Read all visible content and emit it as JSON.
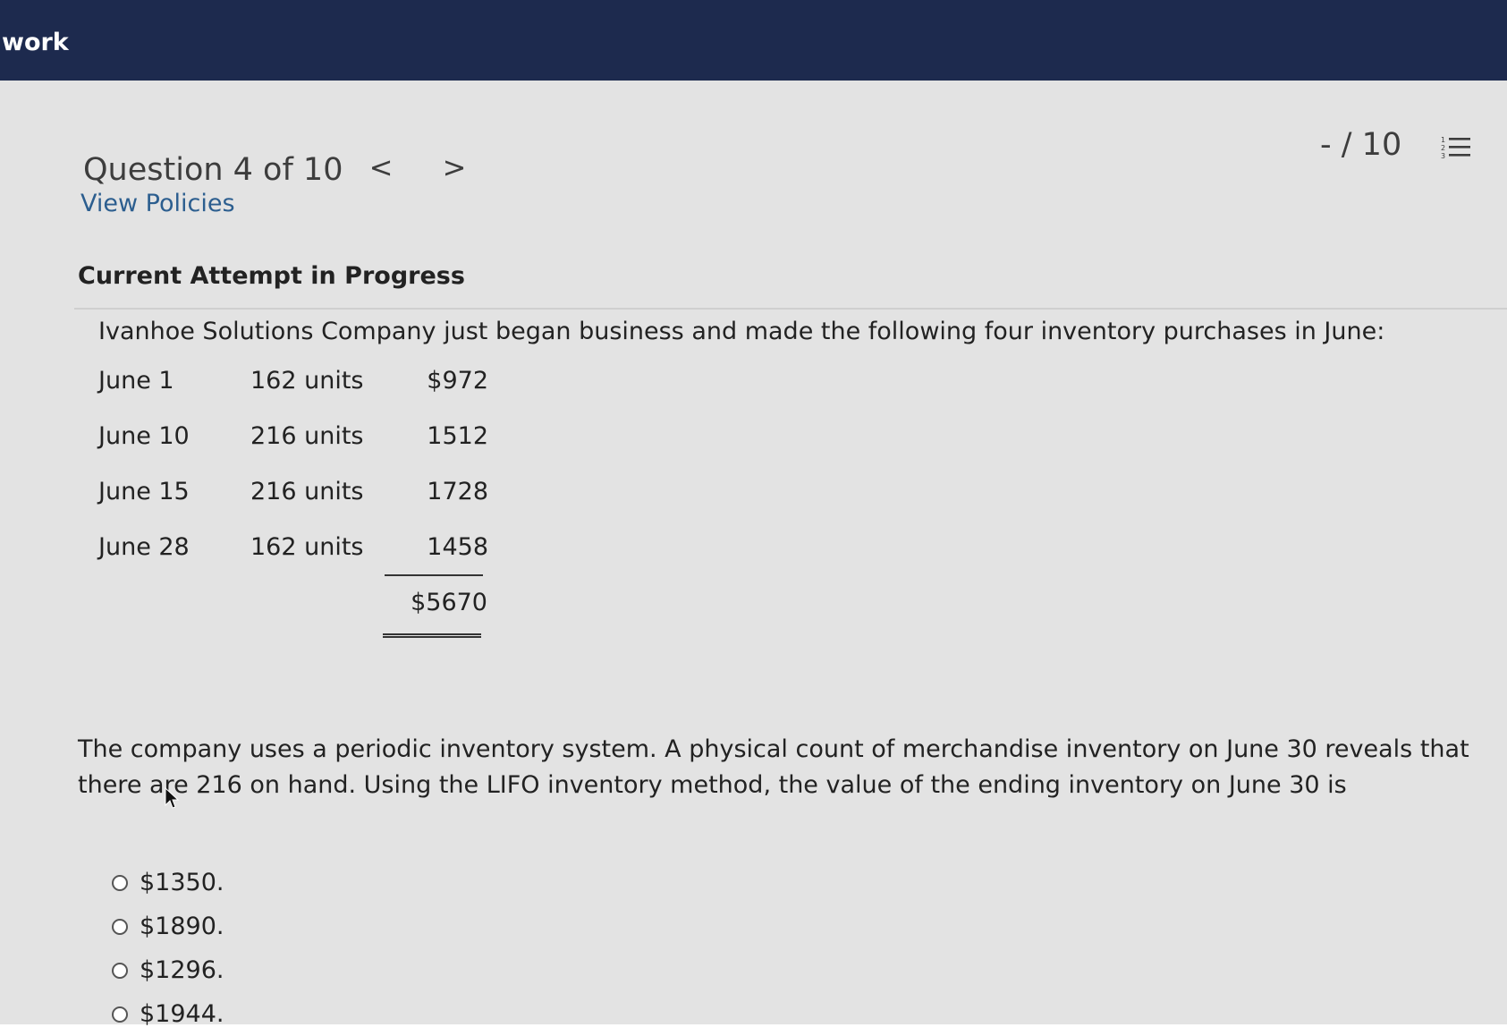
{
  "app": {
    "title": "work"
  },
  "header": {
    "question_counter": "Question 4 of 10",
    "prev_label": "<",
    "next_label": ">",
    "score": "- / 10",
    "list_icon": "numbered-list-icon"
  },
  "links": {
    "view_policies": "View Policies"
  },
  "attempt": {
    "title": "Current Attempt in Progress"
  },
  "question": {
    "intro": "Ivanhoe Solutions Company just began business and made the following four inventory purchases in June:",
    "purchases": [
      {
        "date": "June  1",
        "units": "162 units",
        "cost": "$972"
      },
      {
        "date": "June  10",
        "units": "216 units",
        "cost": "1512"
      },
      {
        "date": "June  15",
        "units": "216 units",
        "cost": "1728"
      },
      {
        "date": "June  28",
        "units": "162 units",
        "cost": "1458"
      }
    ],
    "total": "$5670",
    "stem": "The company uses a periodic inventory system. A physical count of merchandise inventory on June 30 reveals that there are 216 on hand. Using the LIFO inventory method, the value of the ending inventory on June 30 is",
    "options": [
      "$1350.",
      "$1890.",
      "$1296.",
      "$1944."
    ]
  },
  "colors": {
    "topbar": "#1d2a4e",
    "page_bg": "#e3e3e3",
    "link": "#2c5e8f"
  }
}
